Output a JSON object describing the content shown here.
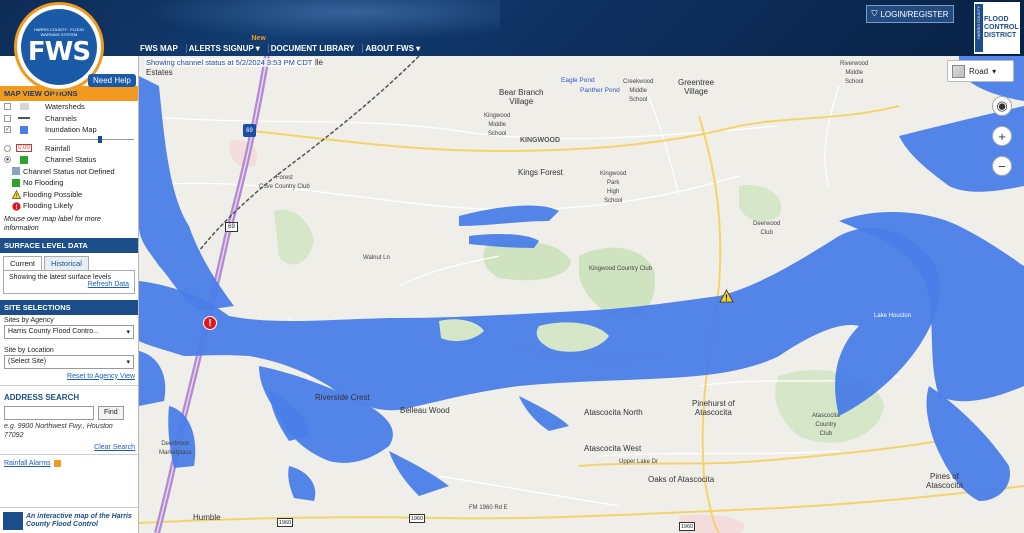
{
  "header": {
    "logo_text": "FWS",
    "logo_ring_text": "HARRIS COUNTY · FLOOD WARNING SYSTEM",
    "need_help": "Need Help",
    "nav": [
      {
        "label": "FWS MAP"
      },
      {
        "label": "ALERTS SIGNUP ▾",
        "badge": "New"
      },
      {
        "label": "DOCUMENT LIBRARY"
      },
      {
        "label": "ABOUT FWS ▾"
      }
    ],
    "login": "LOGIN/REGISTER",
    "district": [
      "FLOOD",
      "CONTROL",
      "DISTRICT"
    ],
    "district_side": "HARRIS COUNTY"
  },
  "sidebar": {
    "map_view_title": "MAP VIEW OPTIONS",
    "layers": [
      {
        "label": "Watersheds",
        "checked": false
      },
      {
        "label": "Channels",
        "checked": false
      },
      {
        "label": "Inundation Map",
        "checked": true
      },
      {
        "label": "Rainfall",
        "checked": false,
        "value": "0.00"
      },
      {
        "label": "Channel Status",
        "checked": true
      }
    ],
    "legend": [
      {
        "label": "Channel Status not Defined",
        "color": "#8aa4c8"
      },
      {
        "label": "No Flooding",
        "color": "#2aa52a"
      },
      {
        "label": "Flooding Possible",
        "color": "#f2d01a"
      },
      {
        "label": "Flooding Likely",
        "color": "#e0171f"
      }
    ],
    "mouse_note": "Mouse over map label for more information",
    "surface_title": "SURFACE LEVEL DATA",
    "tabs": [
      "Current",
      "Historical"
    ],
    "tab_text": "Showing the latest surface levels",
    "refresh": "Refresh Data",
    "site_title": "SITE SELECTIONS",
    "agency_label": "Sites by Agency",
    "agency_value": "Harris County Flood Contro...",
    "location_label": "Site by Location",
    "location_value": "(Select Site)",
    "reset": "Reset to Agency View",
    "address_title": "ADDRESS SEARCH",
    "find": "Find",
    "address_hint": "e.g. 9900 Northwest Fwy., Houston 77092",
    "clear": "Clear Search",
    "rainfall_alarms": "Rainfall Alarms",
    "promo": "An interactive map of the Harris County Flood Control"
  },
  "map": {
    "status": "Showing channel status at 5/2/2024 3:53 PM CDT",
    "map_type": "Road",
    "labels": [
      {
        "text": "Estates",
        "cls": ""
      },
      {
        "text": "lle",
        "cls": ""
      },
      {
        "text": "Bear Branch\nVillage",
        "cls": ""
      },
      {
        "text": "Eagle Pond",
        "cls": "blue"
      },
      {
        "text": "Panther Pond",
        "cls": "blue"
      },
      {
        "text": "Creekwood\nMiddle\nSchool",
        "cls": "small"
      },
      {
        "text": "Greentree\nVillage",
        "cls": ""
      },
      {
        "text": "Riverwood\nMiddle\nSchool",
        "cls": "small"
      },
      {
        "text": "Kingwood\nMiddle\nSchool",
        "cls": "small"
      },
      {
        "text": "KINGWOOD",
        "cls": "bold"
      },
      {
        "text": "Kings Forest",
        "cls": ""
      },
      {
        "text": "Kingwood\nPark\nHigh\nSchool",
        "cls": "small"
      },
      {
        "text": "Forest\nCove Country Club",
        "cls": "small"
      },
      {
        "text": "Deerwood\nClub",
        "cls": "small"
      },
      {
        "text": "Kingwood Country Club",
        "cls": "small"
      },
      {
        "text": "Walnut Ln",
        "cls": "small"
      },
      {
        "text": "Riverside Crest",
        "cls": ""
      },
      {
        "text": "Belleau Wood",
        "cls": ""
      },
      {
        "text": "Atascocita North",
        "cls": ""
      },
      {
        "text": "Pinehurst of\nAtascocita",
        "cls": ""
      },
      {
        "text": "Atascocita\nCountry\nClub",
        "cls": "small"
      },
      {
        "text": "Atascocita West",
        "cls": ""
      },
      {
        "text": "Oaks of Atascocita",
        "cls": ""
      },
      {
        "text": "Pines of\nAtascocita",
        "cls": ""
      },
      {
        "text": "Humble",
        "cls": ""
      },
      {
        "text": "Deerbrook\nMarketplace",
        "cls": "small"
      },
      {
        "text": "Lake Houston",
        "cls": "small"
      },
      {
        "text": "FM 1960 Rd E",
        "cls": "small"
      },
      {
        "text": "Upper Lake Dr",
        "cls": "small"
      }
    ],
    "shields": [
      "69",
      "1960",
      "1960",
      "1960"
    ],
    "interstate": "69",
    "controls": {
      "locate": "◉",
      "zoom_in": "+",
      "zoom_out": "−"
    }
  }
}
